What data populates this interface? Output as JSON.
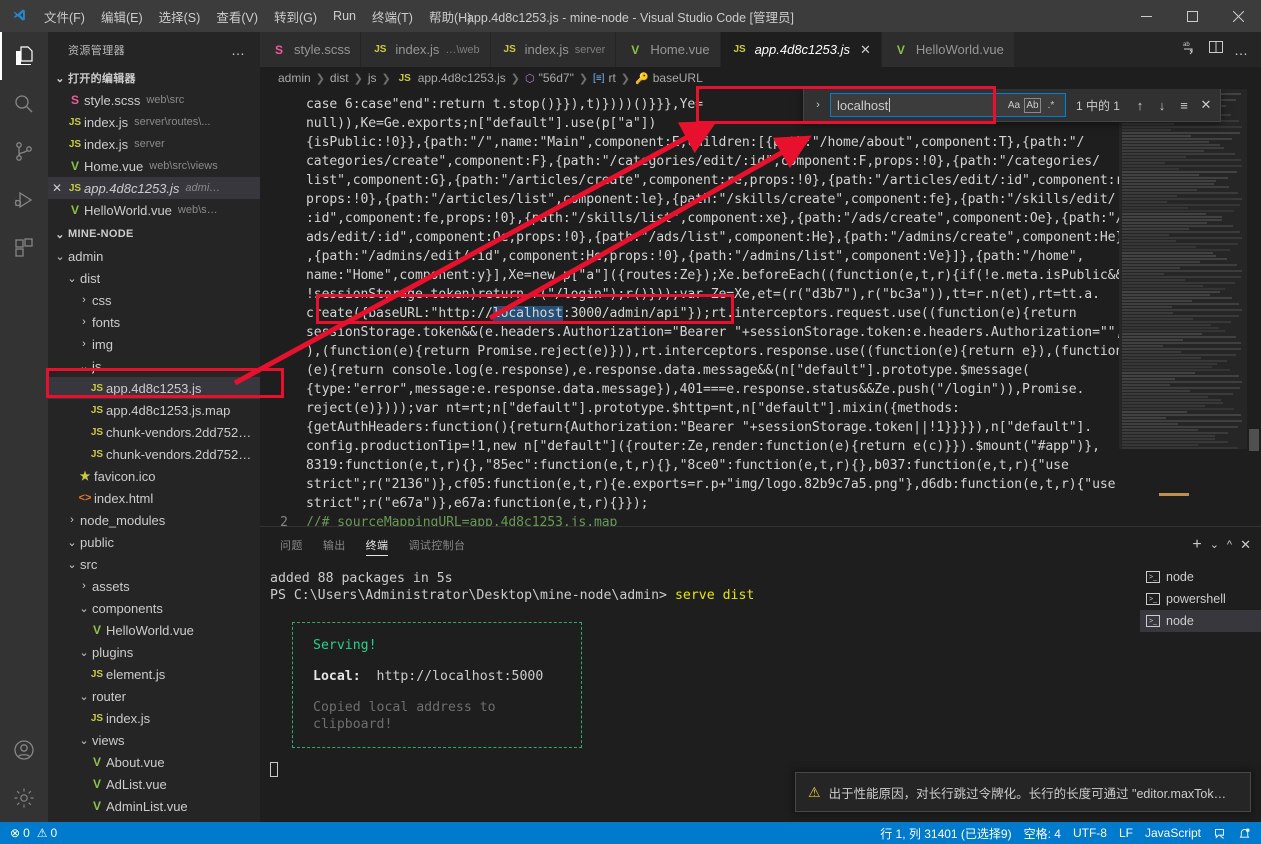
{
  "window": {
    "title": "app.4d8c1253.js - mine-node - Visual Studio Code [管理员]",
    "minimize": "−",
    "maximize": "□",
    "close": "✕"
  },
  "menubar": [
    {
      "label": "文件(F)"
    },
    {
      "label": "编辑(E)"
    },
    {
      "label": "选择(S)"
    },
    {
      "label": "查看(V)"
    },
    {
      "label": "转到(G)"
    },
    {
      "label": "Run"
    },
    {
      "label": "终端(T)"
    },
    {
      "label": "帮助(H)"
    }
  ],
  "activitybar": [
    {
      "name": "explorer",
      "active": true
    },
    {
      "name": "search",
      "active": false
    },
    {
      "name": "source-control",
      "active": false
    },
    {
      "name": "run-and-debug",
      "active": false
    },
    {
      "name": "extensions",
      "active": false
    },
    {
      "name": "accounts",
      "active": false
    },
    {
      "name": "settings",
      "active": false
    }
  ],
  "sidebar": {
    "title": "资源管理器",
    "more": "…",
    "open_editors": {
      "title": "打开的编辑器",
      "twisty": "⌄",
      "items": [
        {
          "icon": "scss",
          "glyph": "S",
          "name": "style.scss",
          "desc": "web\\src",
          "selected": false,
          "italic": false,
          "close": ""
        },
        {
          "icon": "js",
          "glyph": "JS",
          "name": "index.js",
          "desc": "server\\routes\\...",
          "selected": false,
          "italic": false,
          "close": ""
        },
        {
          "icon": "js",
          "glyph": "JS",
          "name": "index.js",
          "desc": "server",
          "selected": false,
          "italic": false,
          "close": ""
        },
        {
          "icon": "vue",
          "glyph": "V",
          "name": "Home.vue",
          "desc": "web\\src\\views",
          "selected": false,
          "italic": false,
          "close": ""
        },
        {
          "icon": "js",
          "glyph": "JS",
          "name": "app.4d8c1253.js",
          "desc": "admi…",
          "selected": true,
          "italic": true,
          "close": "✕"
        },
        {
          "icon": "vue",
          "glyph": "V",
          "name": "HelloWorld.vue",
          "desc": "web\\s…",
          "selected": false,
          "italic": false,
          "close": ""
        }
      ]
    },
    "project": {
      "title": "MINE-NODE",
      "twisty": "⌄",
      "tree": [
        {
          "depth": 1,
          "kind": "folder",
          "twisty": "⌄",
          "name": "admin",
          "icon": "",
          "glyph": "",
          "selected": false
        },
        {
          "depth": 2,
          "kind": "folder",
          "twisty": "⌄",
          "name": "dist",
          "icon": "",
          "glyph": "",
          "selected": false
        },
        {
          "depth": 3,
          "kind": "folder",
          "twisty": "›",
          "name": "css",
          "icon": "",
          "glyph": "",
          "selected": false
        },
        {
          "depth": 3,
          "kind": "folder",
          "twisty": "›",
          "name": "fonts",
          "icon": "",
          "glyph": "",
          "selected": false
        },
        {
          "depth": 3,
          "kind": "folder",
          "twisty": "›",
          "name": "img",
          "icon": "",
          "glyph": "",
          "selected": false
        },
        {
          "depth": 3,
          "kind": "folder",
          "twisty": "⌄",
          "name": "js",
          "icon": "",
          "glyph": "",
          "selected": false
        },
        {
          "depth": 4,
          "kind": "file",
          "twisty": "",
          "name": "app.4d8c1253.js",
          "icon": "js",
          "glyph": "JS",
          "selected": true
        },
        {
          "depth": 4,
          "kind": "file",
          "twisty": "",
          "name": "app.4d8c1253.js.map",
          "icon": "js",
          "glyph": "JS",
          "selected": false
        },
        {
          "depth": 4,
          "kind": "file",
          "twisty": "",
          "name": "chunk-vendors.2dd752…",
          "icon": "js",
          "glyph": "JS",
          "selected": false
        },
        {
          "depth": 4,
          "kind": "file",
          "twisty": "",
          "name": "chunk-vendors.2dd752…",
          "icon": "js",
          "glyph": "JS",
          "selected": false
        },
        {
          "depth": 3,
          "kind": "file",
          "twisty": "",
          "name": "favicon.ico",
          "icon": "ico",
          "glyph": "★",
          "selected": false
        },
        {
          "depth": 3,
          "kind": "file",
          "twisty": "",
          "name": "index.html",
          "icon": "html",
          "glyph": "<>",
          "selected": false
        },
        {
          "depth": 2,
          "kind": "folder",
          "twisty": "›",
          "name": "node_modules",
          "icon": "",
          "glyph": "",
          "selected": false
        },
        {
          "depth": 2,
          "kind": "folder",
          "twisty": "⌄",
          "name": "public",
          "icon": "",
          "glyph": "",
          "selected": false
        },
        {
          "depth": 2,
          "kind": "folder",
          "twisty": "⌄",
          "name": "src",
          "icon": "",
          "glyph": "",
          "selected": false
        },
        {
          "depth": 3,
          "kind": "folder",
          "twisty": "›",
          "name": "assets",
          "icon": "",
          "glyph": "",
          "selected": false
        },
        {
          "depth": 3,
          "kind": "folder",
          "twisty": "⌄",
          "name": "components",
          "icon": "",
          "glyph": "",
          "selected": false
        },
        {
          "depth": 4,
          "kind": "file",
          "twisty": "",
          "name": "HelloWorld.vue",
          "icon": "vue",
          "glyph": "V",
          "selected": false
        },
        {
          "depth": 3,
          "kind": "folder",
          "twisty": "⌄",
          "name": "plugins",
          "icon": "",
          "glyph": "",
          "selected": false
        },
        {
          "depth": 4,
          "kind": "file",
          "twisty": "",
          "name": "element.js",
          "icon": "js",
          "glyph": "JS",
          "selected": false
        },
        {
          "depth": 3,
          "kind": "folder",
          "twisty": "⌄",
          "name": "router",
          "icon": "",
          "glyph": "",
          "selected": false
        },
        {
          "depth": 4,
          "kind": "file",
          "twisty": "",
          "name": "index.js",
          "icon": "js",
          "glyph": "JS",
          "selected": false
        },
        {
          "depth": 3,
          "kind": "folder",
          "twisty": "⌄",
          "name": "views",
          "icon": "",
          "glyph": "",
          "selected": false
        },
        {
          "depth": 4,
          "kind": "file",
          "twisty": "",
          "name": "About.vue",
          "icon": "vue",
          "glyph": "V",
          "selected": false
        },
        {
          "depth": 4,
          "kind": "file",
          "twisty": "",
          "name": "AdList.vue",
          "icon": "vue",
          "glyph": "V",
          "selected": false
        },
        {
          "depth": 4,
          "kind": "file",
          "twisty": "",
          "name": "AdminList.vue",
          "icon": "vue",
          "glyph": "V",
          "selected": false
        },
        {
          "depth": 4,
          "kind": "file",
          "twisty": "",
          "name": "AdminSet.vue",
          "icon": "vue",
          "glyph": "V",
          "selected": false
        }
      ]
    }
  },
  "tabs": [
    {
      "icon": "scss",
      "glyph": "S",
      "label": "style.scss",
      "desc": "",
      "active": false,
      "italic": false,
      "close": ""
    },
    {
      "icon": "js",
      "glyph": "JS",
      "label": "index.js",
      "desc": "…\\web",
      "active": false,
      "italic": false,
      "close": ""
    },
    {
      "icon": "js",
      "glyph": "JS",
      "label": "index.js",
      "desc": "server",
      "active": false,
      "italic": false,
      "close": ""
    },
    {
      "icon": "vue",
      "glyph": "V",
      "label": "Home.vue",
      "desc": "",
      "active": false,
      "italic": false,
      "close": ""
    },
    {
      "icon": "js",
      "glyph": "JS",
      "label": "app.4d8c1253.js",
      "desc": "",
      "active": true,
      "italic": true,
      "close": "✕"
    },
    {
      "icon": "vue",
      "glyph": "V",
      "label": "HelloWorld.vue",
      "desc": "",
      "active": false,
      "italic": false,
      "close": ""
    }
  ],
  "breadcrumb": [
    {
      "label": "admin",
      "sym": ""
    },
    {
      "label": "dist",
      "sym": ""
    },
    {
      "label": "js",
      "sym": ""
    },
    {
      "label": "app.4d8c1253.js",
      "sym": "js"
    },
    {
      "label": "\"56d7\"",
      "sym": "cube"
    },
    {
      "label": "rt",
      "sym": "var"
    },
    {
      "label": "baseURL",
      "sym": "key"
    }
  ],
  "find": {
    "query": "localhost",
    "placeholder": "查找",
    "match_case_label": "Aa",
    "whole_word_label": "Ab",
    "regex_label": ".*",
    "result_count": "1 中的 1",
    "prev": "↑",
    "next": "↓",
    "find_in_selection": "≡",
    "close": "✕",
    "expand": "›"
  },
  "editor": {
    "line_numbers": [
      "",
      "2"
    ],
    "code_lines": [
      "case 6:case\"end\":return t.stop()}}),t)})))()}}},Ye=",
      "null)),Ke=Ge.exports;n[\"default\"].use(p[\"a\"])",
      "{isPublic:!0}},{path:\"/\",name:\"Main\",component:E,children:[{path:\"/home/about\",component:T},{path:\"/",
      "categories/create\",component:F},{path:\"/categories/edit/:id\",component:F,props:!0},{path:\"/categories/",
      "list\",component:G},{path:\"/articles/create\",component:re,props:!0},{path:\"/articles/edit/:id\",component:re,",
      "props:!0},{path:\"/articles/list\",component:le},{path:\"/skills/create\",component:fe},{path:\"/skills/edit/",
      ":id\",component:fe,props:!0},{path:\"/skills/list\",component:xe},{path:\"/ads/create\",component:Oe},{path:\"/",
      "ads/edit/:id\",component:Oe,props:!0},{path:\"/ads/list\",component:He},{path:\"/admins/create\",component:He}",
      ",{path:\"/admins/edit/:id\",component:He,props:!0},{path:\"/admins/list\",component:Ve}]},{path:\"/home\",",
      "name:\"Home\",component:y}],Xe=new p[\"a\"]({routes:Ze});Xe.beforeEach((function(e,t,r){if(!e.meta.isPublic&&",
      "!sessionStorage.token)return r(\"/login\");r()}));var Ze=Xe,et=(r(\"d3b7\"),r(\"bc3a\")),tt=r.n(et),rt=tt.a.",
      "create({baseURL:\"http://localhost:3000/admin/api\"});rt.interceptors.request.use((function(e){return",
      "sessionStorage.token&&(e.headers.Authorization=\"Bearer \"+sessionStorage.token:e.headers.Authorization=\"\",e}",
      "),(function(e){return Promise.reject(e)})),rt.interceptors.response.use((function(e){return e}),(function",
      "(e){return console.log(e.response),e.response.data.message&&(n[\"default\"].prototype.$message(",
      "{type:\"error\",message:e.response.data.message}),401===e.response.status&&Ze.push(\"/login\")),Promise.",
      "reject(e)})));var nt=rt;n[\"default\"].prototype.$http=nt,n[\"default\"].mixin({methods:",
      "{getAuthHeaders:function(){return{Authorization:\"Bearer \"+sessionStorage.token||!1}}}}),n[\"default\"].",
      "config.productionTip=!1,new n[\"default\"]({router:Ze,render:function(e){return e(c)}}).$mount(\"#app\")},",
      "8319:function(e,t,r){},\"85ec\":function(e,t,r){},\"8ce0\":function(e,t,r){},b037:function(e,t,r){\"use",
      "strict\";r(\"2136\")},cf05:function(e,t,r){e.exports=r.p+\"img/logo.82b9c7a5.png\"},d6db:function(e,t,r){\"use",
      "strict\";r(\"e67a\")},e67a:function(e,t,r){}});"
    ],
    "baseurl_line_prefix": "create({baseURL:\"http://",
    "baseurl_match": "localhost",
    "baseurl_line_suffix": ":3000/admin/api\"});rt.interceptors.request.use((function(e){return",
    "sourcemap_comment": "//# sourceMappingURL=app.4d8c1253.js.map"
  },
  "panel": {
    "tabs": [
      {
        "label": "问题",
        "active": false
      },
      {
        "label": "输出",
        "active": false
      },
      {
        "label": "终端",
        "active": true
      },
      {
        "label": "调试控制台",
        "active": false
      }
    ],
    "actions": {
      "new": "+",
      "dropdown": "⌄",
      "maximize": "^",
      "close": "✕"
    },
    "terminal": {
      "line1": "added 88 packages in 5s",
      "prompt": "PS C:\\Users\\Administrator\\Desktop\\mine-node\\admin>",
      "command": "serve dist",
      "serving": "Serving!",
      "local_label": "Local:",
      "local_url": "http://localhost:5000",
      "copied": "Copied local address to clipboard!"
    },
    "terminal_list": [
      {
        "label": "node",
        "selected": false
      },
      {
        "label": "powershell",
        "selected": false
      },
      {
        "label": "node",
        "selected": true
      }
    ]
  },
  "notification": {
    "icon": "⚠",
    "text": "出于性能原因，对长行跳过令牌化。长行的长度可通过 \"editor.maxTok…"
  },
  "statusbar": {
    "errors_icon": "⊗",
    "errors": "0",
    "warnings_icon": "⚠",
    "warnings": "0",
    "position": "行 1, 列 31401 (已选择9)",
    "indent": "空格: 4",
    "encoding": "UTF-8",
    "eol": "LF",
    "language": "JavaScript",
    "feedback_icon": "☺",
    "bell_icon": "🔔"
  },
  "colors": {
    "accent": "#007acc",
    "annotation_red": "#e8112d",
    "titlebar_bg": "#3c3c3c",
    "sidebar_bg": "#252526",
    "editor_bg": "#1e1e1e",
    "selection_blue": "#264f78",
    "serving_green": "#23d18b"
  }
}
